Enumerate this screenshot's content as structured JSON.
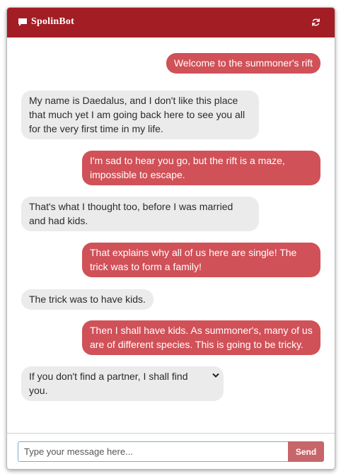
{
  "app": {
    "title": "SpolinBot",
    "icons": {
      "title_icon": "chat-bubble-icon",
      "refresh_icon": "refresh-icon",
      "expand_icon": "chevron-down-icon"
    },
    "colors": {
      "header": "#a21d24",
      "bot_bubble": "#d05158",
      "user_bubble": "#ebebeb",
      "send_button": "#c7666a",
      "input_border": "#6fb3c9"
    }
  },
  "messages": [
    {
      "sender": "bot",
      "text": "Welcome to the summoner's rift"
    },
    {
      "sender": "user",
      "text": "My name is Daedalus, and I don't like this place that much yet I am going back here to see you all for the very first time in my life."
    },
    {
      "sender": "bot",
      "text": "I'm sad to hear you go, but the rift is a maze, impossible to escape."
    },
    {
      "sender": "user",
      "text": "That's what I thought too, before I was married and had kids."
    },
    {
      "sender": "bot",
      "text": "That explains why all of us here are single! The trick was to form a family!"
    },
    {
      "sender": "user",
      "text": "The trick was to have kids."
    },
    {
      "sender": "bot",
      "text": "Then I shall have kids. As summoner's, many of us are of different species. This is going to be tricky."
    },
    {
      "sender": "user",
      "text": "If you don't find a partner, I shall find you."
    }
  ],
  "composer": {
    "placeholder": "Type your message here...",
    "value": "",
    "send_label": "Send"
  }
}
